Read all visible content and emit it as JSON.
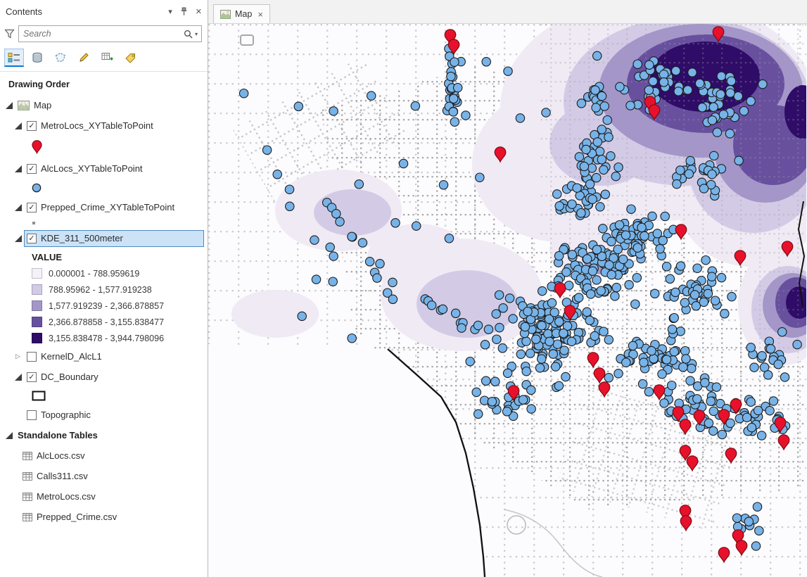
{
  "panel": {
    "title": "Contents",
    "search_placeholder": "Search",
    "drawing_order_label": "Drawing Order",
    "toolbar": [
      {
        "name": "list-by-drawing-order",
        "active": true
      },
      {
        "name": "list-by-source",
        "active": false
      },
      {
        "name": "list-by-selection",
        "active": false
      },
      {
        "name": "list-by-editing",
        "active": false
      },
      {
        "name": "list-by-charts",
        "active": false
      },
      {
        "name": "list-by-labeling",
        "active": false
      }
    ],
    "tree": [
      {
        "type": "layer",
        "indent": 0,
        "expander": "open",
        "icon": "map",
        "label": "Map"
      },
      {
        "type": "layer",
        "indent": 1,
        "expander": "open",
        "checked": true,
        "label": "MetroLocs_XYTableToPoint"
      },
      {
        "type": "symbol",
        "indent": 2,
        "symbol": "red-pin"
      },
      {
        "type": "layer",
        "indent": 1,
        "expander": "open",
        "checked": true,
        "label": "AlcLocs_XYTableToPoint"
      },
      {
        "type": "symbol",
        "indent": 2,
        "symbol": "blue-circle"
      },
      {
        "type": "layer",
        "indent": 1,
        "expander": "open",
        "checked": true,
        "label": "Prepped_Crime_XYTableToPoint"
      },
      {
        "type": "symbol",
        "indent": 2,
        "symbol": "gray-dot"
      },
      {
        "type": "layer",
        "indent": 1,
        "expander": "open",
        "checked": true,
        "label": "KDE_311_500meter",
        "selected": true
      },
      {
        "type": "legend-title",
        "indent": 2,
        "label": "VALUE"
      },
      {
        "type": "legend-item",
        "indent": 2,
        "swatch": "#f4f1f8",
        "label": "0.000001 - 788.959619"
      },
      {
        "type": "legend-item",
        "indent": 2,
        "swatch": "#d3cbe6",
        "label": "788.95962 - 1,577.919238"
      },
      {
        "type": "legend-item",
        "indent": 2,
        "swatch": "#a496c9",
        "label": "1,577.919239 - 2,366.878857"
      },
      {
        "type": "legend-item",
        "indent": 2,
        "swatch": "#68509f",
        "label": "2,366.878858 - 3,155.838477"
      },
      {
        "type": "legend-item",
        "indent": 2,
        "swatch": "#2f0c68",
        "label": "3,155.838478 - 3,944.798096"
      },
      {
        "type": "layer",
        "indent": 1,
        "expander": "closed",
        "checked": false,
        "label": "KernelD_AlcL1"
      },
      {
        "type": "layer",
        "indent": 1,
        "expander": "open",
        "checked": true,
        "label": "DC_Boundary"
      },
      {
        "type": "symbol",
        "indent": 2,
        "symbol": "hollow-square"
      },
      {
        "type": "layer",
        "indent": 1,
        "checked": false,
        "label": "Topographic"
      },
      {
        "type": "group",
        "indent": 0,
        "expander": "open",
        "label": "Standalone Tables"
      },
      {
        "type": "table",
        "indent": 1,
        "icon": "table",
        "label": "AlcLocs.csv"
      },
      {
        "type": "table",
        "indent": 1,
        "icon": "table",
        "label": "Calls311.csv"
      },
      {
        "type": "table",
        "indent": 1,
        "icon": "table",
        "label": "MetroLocs.csv"
      },
      {
        "type": "table",
        "indent": 1,
        "icon": "table",
        "label": "Prepped_Crime.csv"
      }
    ]
  },
  "map_view": {
    "tab_label": "Map",
    "close_glyph": "×",
    "colors": {
      "background": "#fcfbfd",
      "street_dot": "#9b9b9b",
      "point_fill": "#77b3e8",
      "point_stroke": "#1c1c1c",
      "pin_fill": "#e8112b",
      "pin_stroke": "#7e0a12",
      "boundary": "#111111",
      "kde_ramp": [
        "#efeaf4",
        "#d3cbe6",
        "#a496c9",
        "#68509f",
        "#2f0c68"
      ]
    }
  }
}
